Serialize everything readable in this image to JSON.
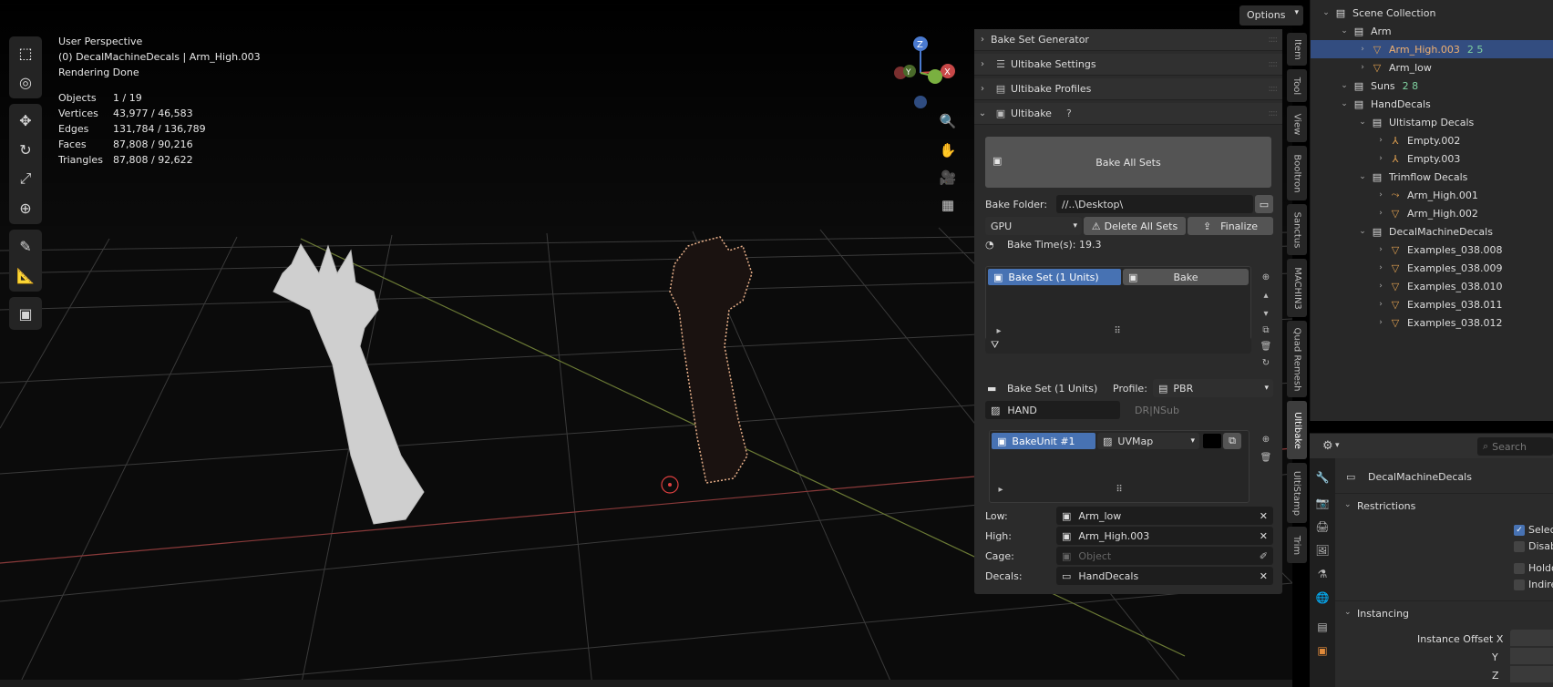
{
  "viewport": {
    "perspective": "User Perspective",
    "context": "(0) DecalMachineDecals | Arm_High.003",
    "status": "Rendering Done",
    "stats": [
      {
        "key": "Objects",
        "value": "1 / 19"
      },
      {
        "key": "Vertices",
        "value": "43,977 / 46,583"
      },
      {
        "key": "Edges",
        "value": "131,784 / 136,789"
      },
      {
        "key": "Faces",
        "value": "87,808 / 90,216"
      },
      {
        "key": "Triangles",
        "value": "87,808 / 92,622"
      }
    ],
    "options_label": "Options",
    "gizmo": {
      "x": "X",
      "y": "Y",
      "z": "Z"
    }
  },
  "npanel": {
    "panels": {
      "bake_set_generator": "Bake Set Generator",
      "ultibake_settings": "Ultibake Settings",
      "ultibake_profiles": "Ultibake Profiles",
      "ultibake": "Ultibake"
    },
    "bake_all_sets": "Bake All Sets",
    "bake_folder_label": "Bake Folder:",
    "bake_folder_value": "//..\\Desktop\\",
    "device": "GPU",
    "delete_all_sets": "Delete All Sets",
    "finalize": "Finalize",
    "bake_time": "Bake Time(s): 19.3",
    "bake_set_item": "Bake Set (1 Units)",
    "bake_button": "Bake",
    "bake_set_label": "Bake Set (1 Units)",
    "profile_label": "Profile:",
    "profile_value": "PBR",
    "name_value": "HAND",
    "name_hint": "DR|NSub",
    "bake_unit": "BakeUnit #1",
    "uvmap": "UVMap",
    "low_label": "Low:",
    "low_value": "Arm_low",
    "high_label": "High:",
    "high_value": "Arm_High.003",
    "cage_label": "Cage:",
    "cage_placeholder": "Object",
    "decals_label": "Decals:",
    "decals_value": "HandDecals"
  },
  "sidetabs": [
    "Item",
    "Tool",
    "View",
    "Booltron",
    "Sanctus",
    "MACHIN3",
    "Quad Remesh",
    "Ultibake",
    "UltiStamp",
    "Trim"
  ],
  "outliner": {
    "rows": [
      {
        "label": "Scene Collection",
        "depth": 0,
        "icon": "collection"
      },
      {
        "label": "Arm",
        "depth": 1,
        "icon": "collection"
      },
      {
        "label": "Arm_High.003",
        "depth": 2,
        "icon": "mesh",
        "selected": true,
        "extra": "2  5"
      },
      {
        "label": "Arm_low",
        "depth": 2,
        "icon": "mesh"
      },
      {
        "label": "Suns",
        "depth": 1,
        "icon": "collection",
        "extra": "2  8"
      },
      {
        "label": "HandDecals",
        "depth": 1,
        "icon": "collection"
      },
      {
        "label": "Ultistamp Decals",
        "depth": 2,
        "icon": "collection"
      },
      {
        "label": "Empty.002",
        "depth": 3,
        "icon": "empty"
      },
      {
        "label": "Empty.003",
        "depth": 3,
        "icon": "empty"
      },
      {
        "label": "Trimflow Decals",
        "depth": 2,
        "icon": "collection"
      },
      {
        "label": "Arm_High.001",
        "depth": 3,
        "icon": "curve"
      },
      {
        "label": "Arm_High.002",
        "depth": 3,
        "icon": "mesh"
      },
      {
        "label": "DecalMachineDecals",
        "depth": 2,
        "icon": "collection"
      },
      {
        "label": "Examples_038.008",
        "depth": 3,
        "icon": "mesh"
      },
      {
        "label": "Examples_038.009",
        "depth": 3,
        "icon": "mesh"
      },
      {
        "label": "Examples_038.010",
        "depth": 3,
        "icon": "mesh"
      },
      {
        "label": "Examples_038.011",
        "depth": 3,
        "icon": "mesh"
      },
      {
        "label": "Examples_038.012",
        "depth": 3,
        "icon": "mesh"
      }
    ]
  },
  "properties": {
    "search_placeholder": "Search",
    "object_name": "DecalMachineDecals",
    "restrictions": "Restrictions",
    "select": "Select",
    "disable": "Disab",
    "holdout": "Holdo",
    "indirect": "Indire",
    "instancing": "Instancing",
    "instance_offset_x": "Instance Offset X",
    "y": "Y",
    "z": "Z"
  },
  "colors": {
    "accent": "#4772b3",
    "selected_row": "#334d80",
    "panel_bg": "#2b2b2b",
    "field_bg": "#1d1d1d"
  }
}
